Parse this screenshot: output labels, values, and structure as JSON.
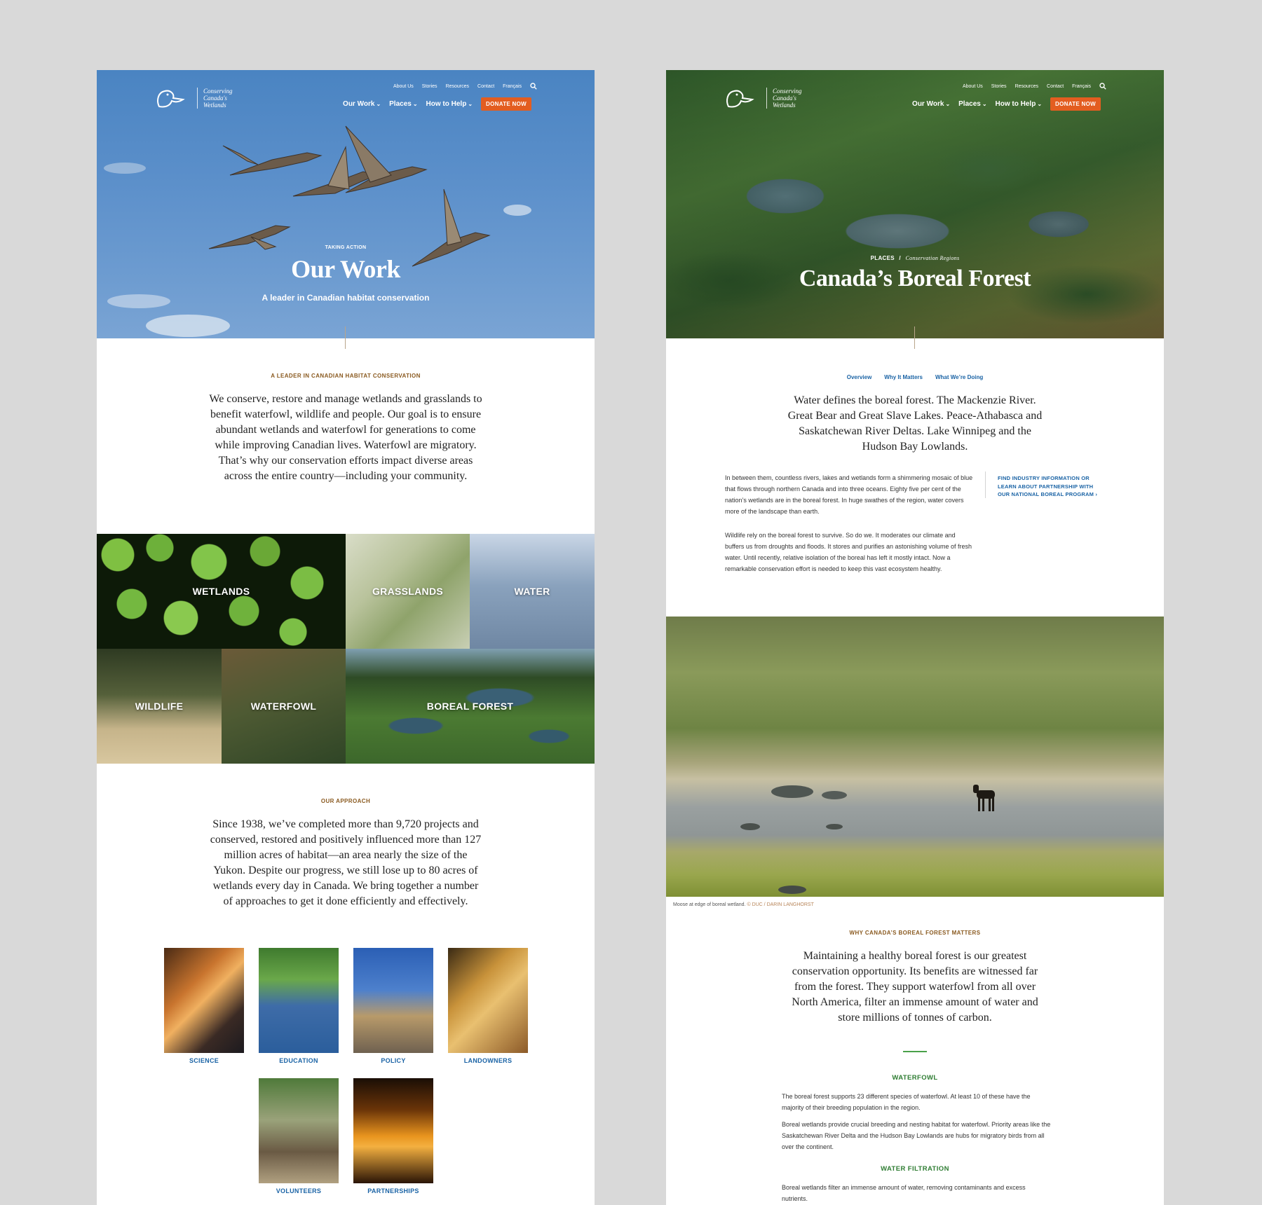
{
  "header": {
    "logo_text": "Conserving\nCanada's\nWetlands",
    "utility_links": [
      "About Us",
      "Stories",
      "Resources",
      "Contact",
      "Français"
    ],
    "main_nav": [
      "Our Work",
      "Places",
      "How to Help"
    ],
    "donate_label": "DONATE NOW"
  },
  "left_page": {
    "hero": {
      "kicker": "TAKING ACTION",
      "title": "Our Work",
      "subtitle": "A leader in Canadian habitat conservation"
    },
    "intro": {
      "eyebrow": "A LEADER IN CANADIAN HABITAT CONSERVATION",
      "text": "We conserve, restore and manage wetlands and grasslands to benefit waterfowl, wildlife and people. Our goal is to ensure abundant wetlands and waterfowl for generations to come while improving Canadian lives. Waterfowl are migratory. That’s why our conservation efforts impact diverse areas across the entire country—including your community."
    },
    "tiles": [
      "WETLANDS",
      "GRASSLANDS",
      "WATER",
      "WILDLIFE",
      "WATERFOWL",
      "BOREAL FOREST"
    ],
    "approach": {
      "eyebrow": "OUR APPROACH",
      "text": "Since 1938, we’ve completed more than 9,720 projects and conserved, restored and positively influenced more than 127 million acres of habitat—an area nearly the size of the Yukon. Despite our progress, we still lose up to 80 acres of wetlands every day in Canada. We bring together a number of approaches to get it done efficiently and effectively.",
      "items": [
        "SCIENCE",
        "EDUCATION",
        "POLICY",
        "LANDOWNERS",
        "VOLUNTEERS",
        "PARTNERSHIPS"
      ]
    }
  },
  "right_page": {
    "hero": {
      "breadcrumb_root": "PLACES",
      "breadcrumb_sep": "/",
      "breadcrumb_current": "Conservation Regions",
      "title": "Canada’s Boreal Forest"
    },
    "tabs": [
      "Overview",
      "Why It Matters",
      "What We’re Doing"
    ],
    "lead": "Water defines the boreal forest. The Mackenzie River. Great Bear and Great Slave Lakes. Peace-Athabasca and Saskatchewan River Deltas. Lake Winnipeg and the Hudson Bay Lowlands.",
    "body_1": "In between them, countless rivers, lakes and wetlands form a shimmering mosaic of blue that flows through northern Canada and into three oceans. Eighty five per cent of the nation’s wetlands are in the boreal forest. In huge swathes of the region, water covers more of the landscape than earth.",
    "body_2": "Wildlife rely on the boreal forest to survive. So do we. It moderates our climate and buffers us from droughts and floods. It stores and purifies an astonishing volume of fresh water. Until recently, relative isolation of the boreal has left it mostly intact. Now a remarkable conservation effort is needed to keep this vast ecosystem healthy.",
    "side_link": "FIND INDUSTRY INFORMATION OR LEARN ABOUT PARTNERSHIP WITH OUR NATIONAL BOREAL PROGRAM ›",
    "caption": "Moose at edge of boreal wetland.",
    "caption_credit": "© DUC / DARIN LANGHORST",
    "matters": {
      "eyebrow": "WHY CANADA’S BOREAL FOREST MATTERS",
      "text": "Maintaining a healthy boreal forest is our greatest conservation opportunity. Its benefits are witnessed far from the forest. They support waterfowl from all over North America, filter an immense amount of water and store millions of tonnes of carbon."
    },
    "waterfowl": {
      "heading": "WATERFOWL",
      "p1": "The boreal forest supports 23 different species of waterfowl. At least 10 of these have the majority of their breeding population in the region.",
      "p2": "Boreal wetlands provide crucial breeding and nesting habitat for waterfowl. Priority areas like the Saskatchewan River Delta and the Hudson Bay Lowlands are hubs for migratory birds from all over the continent."
    },
    "water_filtration": {
      "heading": "WATER FILTRATION",
      "p1": "Boreal wetlands filter an immense amount of water, removing contaminants and excess nutrients."
    }
  },
  "colors": {
    "background": "#d9d9d9",
    "donate": "#e35d20",
    "eyebrow": "#8a5a20",
    "link_blue": "#1a63a5",
    "green_heading": "#2f7d33"
  }
}
